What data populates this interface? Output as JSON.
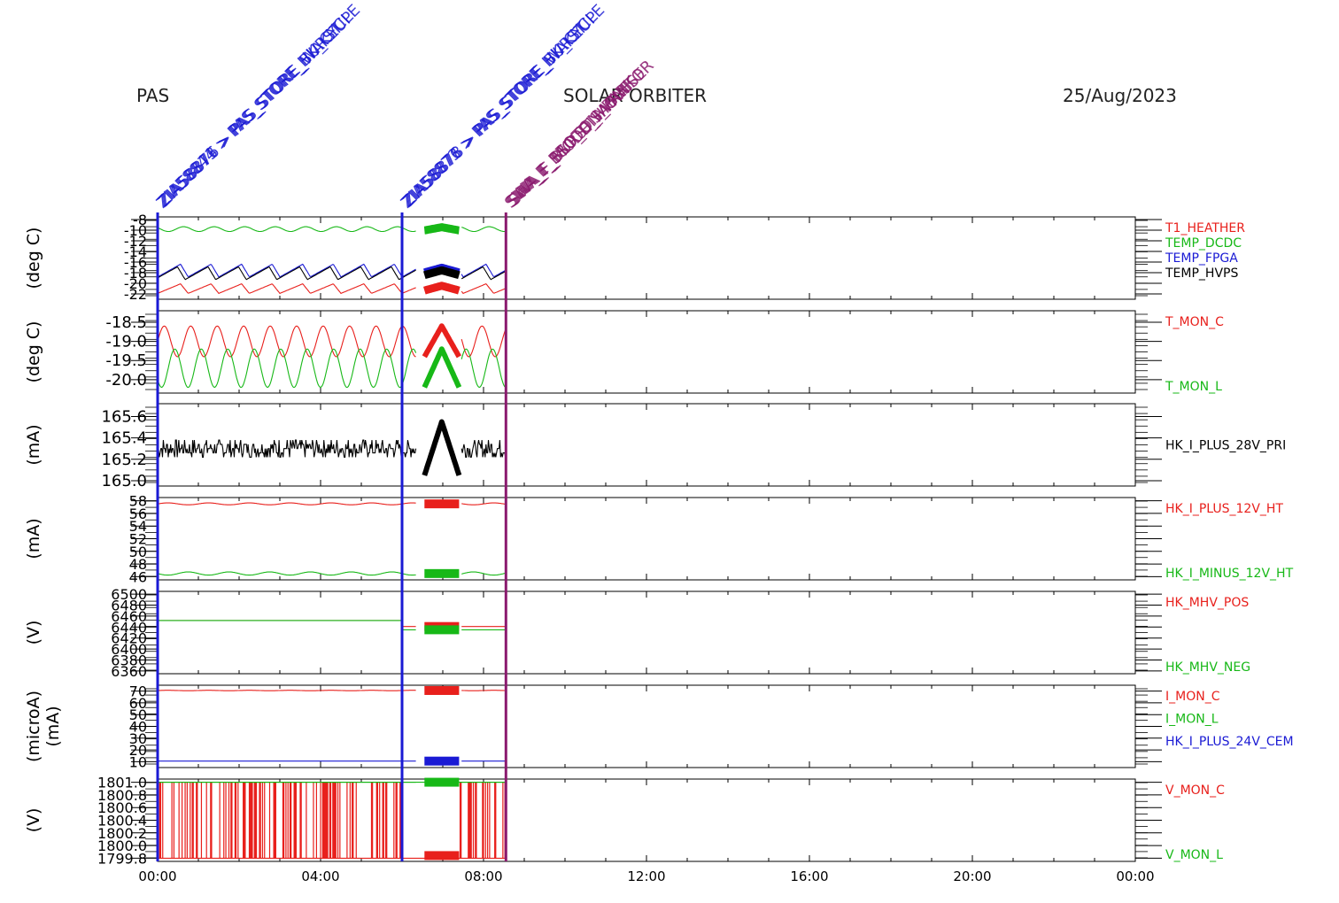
{
  "header": {
    "instrument": "PAS",
    "mission": "SOLAR ORBITER",
    "date": "25/Aug/2023"
  },
  "colors": {
    "red": "#e8201c",
    "green": "#17b817",
    "blue": "#1a1ad4",
    "black": "#000000",
    "purple": "#8a1a6e"
  },
  "events": [
    {
      "time_h": 0.0,
      "color": "#1a1ad4",
      "labels": [
        "ZIA58844 > PAS_STORE_HK_CYCLE",
        "ZIA58873 > PAS_STORE_BURST",
        "ZIA58876 > PAS_STORE_WAKEUP"
      ]
    },
    {
      "time_h": 6.0,
      "color": "#1a1ad4",
      "labels": [
        "ZIA58873 > PAS_STORE_HK_CYCLE",
        "ZIA58876 > PAS_STORE_BURST",
        "ZIA58878 > PAS_STORE_WAKEUP"
      ]
    },
    {
      "time_h": 8.55,
      "color": "#8a1a6e",
      "labels": [
        "SWA_E_PROTON_PARK",
        "SWA_F_SSO_DISABLE",
        "SWA_F_BURST_MONITOR",
        "SWA_F_MODE_HVRAISE"
      ]
    }
  ],
  "chart_data": {
    "type": "line",
    "x_axis": {
      "ticks": [
        "00:00",
        "04:00",
        "08:00",
        "12:00",
        "16:00",
        "20:00",
        "00:00"
      ],
      "range_h": [
        0,
        24
      ]
    },
    "panels": [
      {
        "ylabel": "(deg C)",
        "ytick_labels": [
          "-8",
          "-10",
          "-12",
          "-14",
          "-16",
          "-18",
          "-20",
          "-22"
        ],
        "ylim": [
          -23,
          -7.5
        ],
        "series": [
          {
            "name": "T1_HEATHER",
            "color": "#e8201c",
            "mean": -21.0,
            "amp": 0.9,
            "period_h": 0.75,
            "phase": 0.0,
            "wave": "saw",
            "burst": "zigzag",
            "burst_amp": 0.9
          },
          {
            "name": "TEMP_DCDC",
            "color": "#17b817",
            "mean": -9.8,
            "amp": 0.45,
            "period_h": 0.75,
            "phase": 0.4,
            "wave": "sine",
            "burst": "zigzag",
            "burst_amp": 0.6
          },
          {
            "name": "TEMP_FPGA",
            "color": "#1a1ad4",
            "mean": -17.6,
            "amp": 1.2,
            "period_h": 0.75,
            "phase": 0.0,
            "wave": "saw",
            "burst": "zigzag",
            "burst_amp": 0.9
          },
          {
            "name": "TEMP_HVPS",
            "color": "#000000",
            "mean": -18.1,
            "amp": 1.2,
            "period_h": 0.75,
            "phase": 0.1,
            "wave": "saw",
            "burst": "zigzag",
            "burst_amp": 0.9
          }
        ]
      },
      {
        "ylabel": "(deg C)",
        "ytick_labels": [
          "-18.5",
          "-19.0",
          "-19.5",
          "-20.0"
        ],
        "ylim": [
          -20.35,
          -18.2
        ],
        "series": [
          {
            "name": "T_MON_C",
            "color": "#e8201c",
            "mean": -19.0,
            "amp": 0.4,
            "period_h": 0.65,
            "phase": 0.0,
            "wave": "sine",
            "burst": "cross",
            "burst_amp": 0.4
          },
          {
            "name": "T_MON_L",
            "color": "#17b817",
            "mean": -19.7,
            "amp": 0.5,
            "period_h": 0.65,
            "phase": 0.6,
            "wave": "sine",
            "burst": "cross",
            "burst_amp": 0.5
          }
        ]
      },
      {
        "ylabel": "(mA)",
        "ytick_labels": [
          "165.6",
          "165.4",
          "165.2",
          "165.0"
        ],
        "ylim": [
          164.95,
          165.72
        ],
        "series": [
          {
            "name": "HK_I_PLUS_28V_PRI",
            "color": "#000000",
            "mean": 165.3,
            "amp": 0.08,
            "period_h": 0.1,
            "phase": 0.0,
            "wave": "noise",
            "burst": "cross",
            "burst_amp": 0.25
          }
        ]
      },
      {
        "ylabel": "(mA)",
        "ytick_labels": [
          "58",
          "56",
          "54",
          "52",
          "50",
          "48",
          "46"
        ],
        "ylim": [
          45.5,
          58.5
        ],
        "series": [
          {
            "name": "HK_I_PLUS_12V_HT",
            "color": "#e8201c",
            "mean": 57.5,
            "amp": 0.15,
            "period_h": 1.0,
            "phase": 0.0,
            "wave": "sine",
            "burst": "block",
            "burst_amp": 0.6
          },
          {
            "name": "HK_I_MINUS_12V_HT",
            "color": "#17b817",
            "mean": 46.5,
            "amp": 0.25,
            "period_h": 1.0,
            "phase": 0.5,
            "wave": "sine",
            "burst": "block",
            "burst_amp": 0.6
          }
        ]
      },
      {
        "ylabel": "(V)",
        "ytick_labels": [
          "6500",
          "6480",
          "6460",
          "6440",
          "6420",
          "6400",
          "6380",
          "6360"
        ],
        "ylim": [
          6355,
          6505
        ],
        "series": [
          {
            "name": "HK_MHV_POS",
            "color": "#e8201c",
            "mean": 6452,
            "amp": 0.5,
            "period_h": 1.0,
            "phase": 0.0,
            "wave": "step",
            "step_value": 6441,
            "burst": "block",
            "burst_amp": 6
          },
          {
            "name": "HK_MHV_NEG",
            "color": "#17b817",
            "mean": 6452,
            "amp": 0.5,
            "period_h": 1.0,
            "phase": 0.0,
            "wave": "step",
            "step_value": 6435,
            "burst": "block",
            "burst_amp": 6
          }
        ]
      },
      {
        "ylabel": "(microA)",
        "ylabel2": "(mA)",
        "ytick_labels": [
          "70",
          "60",
          "50",
          "40",
          "30",
          "20",
          "10"
        ],
        "ylim": [
          5,
          75
        ],
        "series": [
          {
            "name": "I_MON_C",
            "color": "#e8201c",
            "mean": 70.5,
            "amp": 0.2,
            "period_h": 1.0,
            "phase": 0.0,
            "wave": "sine",
            "burst": "block",
            "burst_amp": 3
          },
          {
            "name": "I_MON_L",
            "color": "#17b817",
            "mean": 70.5,
            "amp": 0.2,
            "period_h": 1.0,
            "phase": 0.0,
            "wave": "none",
            "burst": "none",
            "burst_amp": 0
          },
          {
            "name": "HK_I_PLUS_24V_CEM",
            "color": "#1a1ad4",
            "mean": 10.5,
            "amp": 0.0,
            "period_h": 1.0,
            "phase": 0.0,
            "wave": "flat",
            "burst": "block",
            "burst_amp": 2.5
          }
        ]
      },
      {
        "ylabel": "(V)",
        "ytick_labels": [
          "1801.0",
          "1800.8",
          "1800.6",
          "1800.4",
          "1800.2",
          "1800.0",
          "1799.8"
        ],
        "ylim": [
          1799.75,
          1801.05
        ],
        "series": [
          {
            "name": "V_MON_C",
            "color": "#e8201c",
            "mean": 1801.0,
            "amp": 1.2,
            "period_h": 1.0,
            "phase": 0.0,
            "wave": "binary",
            "low": 1799.8,
            "burst": "block",
            "burst_amp": 0.05
          },
          {
            "name": "V_MON_L",
            "color": "#17b817",
            "mean": 1801.0,
            "amp": 0.0,
            "period_h": 1.0,
            "phase": 0.0,
            "wave": "flat",
            "burst": "block",
            "burst_amp": 0.05
          }
        ]
      }
    ]
  }
}
